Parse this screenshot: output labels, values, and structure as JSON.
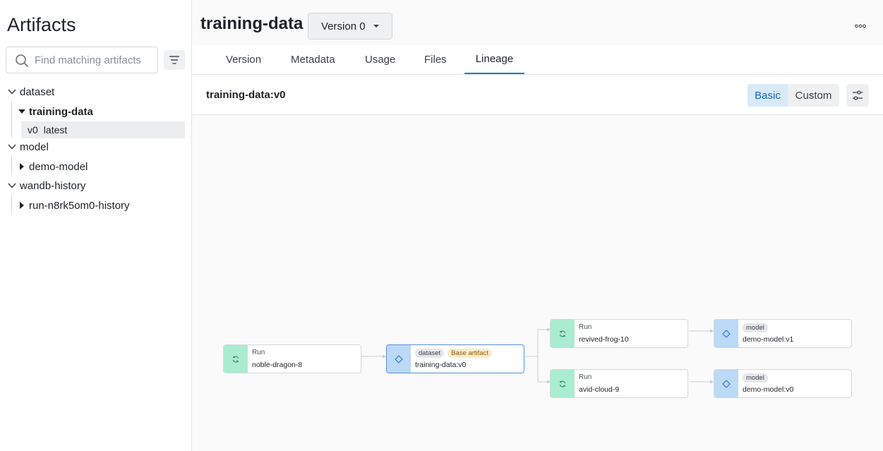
{
  "sidebar": {
    "title": "Artifacts",
    "search_placeholder": "Find matching artifacts",
    "groups": [
      {
        "label": "dataset",
        "children": [
          {
            "label": "training-data",
            "versions": [
              {
                "version": "v0",
                "alias": "latest"
              }
            ]
          }
        ]
      },
      {
        "label": "model",
        "children": [
          {
            "label": "demo-model"
          }
        ]
      },
      {
        "label": "wandb-history",
        "children": [
          {
            "label": "run-n8rk5om0-history"
          }
        ]
      }
    ]
  },
  "header": {
    "title": "training-data",
    "version_select": "Version 0"
  },
  "tabs": [
    "Version",
    "Metadata",
    "Usage",
    "Files",
    "Lineage"
  ],
  "active_tab": "Lineage",
  "lineage": {
    "title": "training-data:v0",
    "mode_basic": "Basic",
    "mode_custom": "Custom",
    "active_mode": "Basic",
    "nodes": [
      {
        "kind": "run",
        "type_label": "Run",
        "name": "noble-dragon-8"
      },
      {
        "kind": "artifact",
        "type_label": "dataset",
        "badge": "Base artifact",
        "name": "training-data:v0"
      },
      {
        "kind": "run",
        "type_label": "Run",
        "name": "revived-frog-10"
      },
      {
        "kind": "run",
        "type_label": "Run",
        "name": "avid-cloud-9"
      },
      {
        "kind": "artifact",
        "type_label": "model",
        "name": "demo-model:v1"
      },
      {
        "kind": "artifact",
        "type_label": "model",
        "name": "demo-model:v0"
      }
    ]
  },
  "colors": {
    "run_strip": "#a9ecd0",
    "artifact_strip": "#bcd9f6",
    "active_tab_underline": "#1b7fb8",
    "basic_active_bg": "#d8eaf8",
    "base_badge_bg": "#fbecc8"
  },
  "icons": {
    "search": "search-icon",
    "filter": "filter-lines-icon",
    "more": "more-horizontal-icon",
    "settings": "sliders-icon",
    "run": "sync-icon",
    "artifact": "diamond-icon"
  }
}
